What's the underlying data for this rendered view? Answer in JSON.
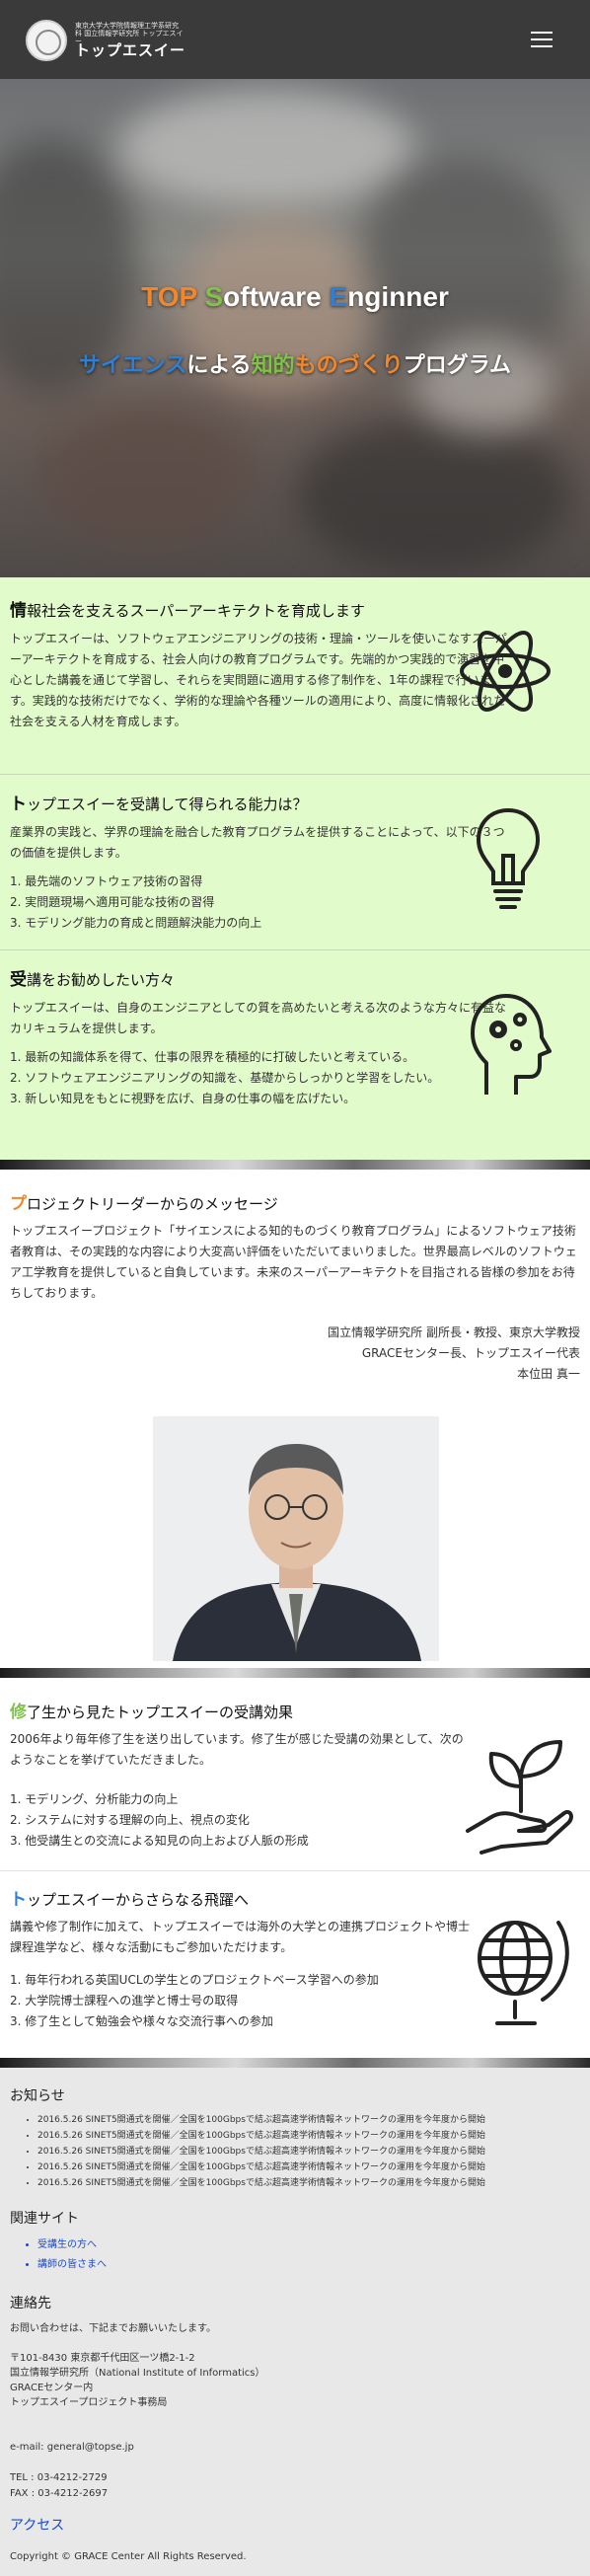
{
  "header": {
    "logo_sub": "東京大学大学院情報理工学系研究科 国立情報学研究所 トップエスイー",
    "logo_name": "トップエスイー"
  },
  "hero": {
    "title": "TOP Software Enginner",
    "title_parts": [
      "T",
      "OP ",
      "S",
      "oftware ",
      "E",
      "nginner"
    ],
    "subtitle_parts": [
      "サイエンス",
      "による",
      "知的",
      "ものづくり",
      "プログラム"
    ],
    "colors": {
      "orange": "#f2862a",
      "green": "#7fc24a",
      "blue": "#2d7fd6",
      "white": "#ffffff"
    }
  },
  "sections": {
    "architect": {
      "title_first": "情",
      "title_rest": "報社会を支えるスーパーアーキテクトを育成します",
      "body": "トップエスイーは、ソフトウェアエンジニアリングの技術・理論・ツールを使いこなすスーパーアーキテクトを育成する、社会人向けの教育プログラムです。先端的かつ実践的で演習を中心とした講義を通じて学習し、それらを実問題に適用する修了制作を、1年の課程で行います。実践的な技術だけでなく、学術的な理論や各種ツールの適用により、高度に情報化された社会を支える人材を育成します。",
      "icon": "atom-icon"
    },
    "abilities": {
      "title_first": "ト",
      "title_rest": "ップエスイーを受講して得られる能力は？",
      "body": "産業界の実践と、学界の理論を融合した教育プログラムを提供することによって、以下の３つの価値を提供します。",
      "items": [
        "1. 最先端のソフトウェア技術の習得",
        "2. 実問題現場へ適用可能な技術の習得",
        "3. モデリング能力の育成と問題解決能力の向上"
      ],
      "icon": "lightbulb-icon"
    },
    "recommend": {
      "title_first": "受",
      "title_rest": "講をお勧めしたい方々",
      "body": "トップエスイーは、自身のエンジニアとしての質を高めたいと考える次のような方々に有益なカリキュラムを提供します。",
      "items": [
        "1. 最新の知識体系を得て、仕事の限界を積極的に打破したいと考えている。",
        "2. ソフトウェアエンジニアリングの知識を、基礎からしっかりと学習をしたい。",
        "3. 新しい知見をもとに視野を広げ、自身の仕事の幅を広げたい。"
      ],
      "icon": "head-gears-icon"
    }
  },
  "message": {
    "title_first": "プ",
    "title_rest": "ロジェクトリーダーからのメッセージ",
    "body": "トップエスイープロジェクト「サイエンスによる知的ものづくり教育プログラム」によるソフトウェア技術者教育は、その実践的な内容により大変高い評価をいただいてまいりました。世界最高レベルのソフトウェア工学教育を提供していると自負しています。未来のスーパーアーキテクトを目指される皆様の参加をお待ちしております。",
    "sig_lines": [
      "国立情報学研究所 副所長・教授、東京大学教授",
      "GRACEセンター長、トップエスイー代表",
      "本位田 真一"
    ]
  },
  "effects": {
    "title_first": "修",
    "title_rest": "了生から見たトップエスイーの受講効果",
    "body": "2006年より毎年修了生を送り出しています。修了生が感じた受講の効果として、次のようなことを挙げていただきました。",
    "items": [
      "1. モデリング、分析能力の向上",
      "2. システムに対する理解の向上、視点の変化",
      "3. 他受講生との交流による知見の向上および人脈の形成"
    ],
    "icon": "plant-hand-icon"
  },
  "leap": {
    "title_first": "ト",
    "title_rest": "ップエスイーからさらなる飛躍へ",
    "body": "講義や修了制作に加えて、トップエスイーでは海外の大学との連携プロジェクトや博士課程進学など、様々な活動にもご参加いただけます。",
    "items": [
      "1. 毎年行われる英国UCLの学生とのプロジェクトベース学習への参加",
      "2. 大学院博士課程への進学と博士号の取得",
      "3. 修了生として勉強会や様々な交流行事への参加"
    ],
    "icon": "globe-icon"
  },
  "footer": {
    "news_title": "お知らせ",
    "news": [
      "2016.5.26 SINET5開通式を開催／全国を100Gbpsで結ぶ超高速学術情報ネットワークの運用を今年度から開始",
      "2016.5.26 SINET5開通式を開催／全国を100Gbpsで結ぶ超高速学術情報ネットワークの運用を今年度から開始",
      "2016.5.26 SINET5開通式を開催／全国を100Gbpsで結ぶ超高速学術情報ネットワークの運用を今年度から開始",
      "2016.5.26 SINET5開通式を開催／全国を100Gbpsで結ぶ超高速学術情報ネットワークの運用を今年度から開始",
      "2016.5.26 SINET5開通式を開催／全国を100Gbpsで結ぶ超高速学術情報ネットワークの運用を今年度から開始"
    ],
    "related_title": "関連サイト",
    "related": [
      "受講生の方へ",
      "講師の皆さまへ"
    ],
    "contact_title": "連絡先",
    "contact_intro": "お問い合わせは、下記までお願いいたします。",
    "address": [
      "〒101-8430 東京都千代田区一ツ橋2-1-2",
      "国立情報学研究所（National Institute of Informatics）",
      "GRACEセンター内",
      "トップエスイープロジェクト事務局"
    ],
    "email": "e-mail: general@topse.jp",
    "tel": "TEL : 03-4212-2729",
    "fax": "FAX : 03-4212-2697",
    "access": "アクセス",
    "copyright": "Copyright © GRACE Center All Rights Reserved."
  }
}
